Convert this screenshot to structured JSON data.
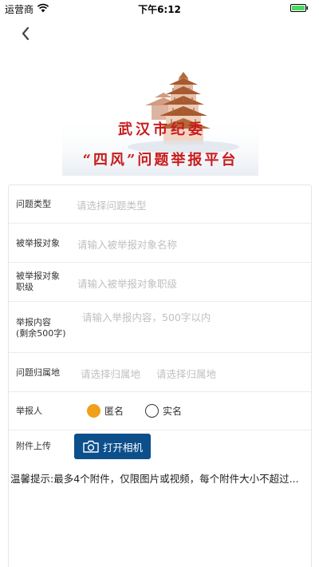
{
  "status_bar": {
    "carrier": "运营商",
    "time": "下午6:12",
    "battery_color": "#4cd964"
  },
  "nav": {
    "back_icon": "chevron-left-icon"
  },
  "banner": {
    "line1": "武汉市纪委",
    "line2": "“四风”问题举报平台",
    "text_color": "#c91b1b"
  },
  "form": {
    "issue_type": {
      "label": "问题类型",
      "placeholder": "请选择问题类型"
    },
    "target_name": {
      "label": "被举报对象",
      "placeholder": "请输入被举报对象名称"
    },
    "target_rank": {
      "label_line1": "被举报对象",
      "label_line2": "职级",
      "placeholder": "请输入被举报对象职级"
    },
    "content": {
      "label_line1": "举报内容",
      "label_line2": "(剩余500字)",
      "placeholder": "请输入举报内容，500字以内"
    },
    "location": {
      "label": "问题归属地",
      "placeholder1": "请选择归属地",
      "placeholder2": "请选择归属地"
    },
    "reporter": {
      "label": "举报人",
      "options": [
        {
          "label": "匿名",
          "selected": true
        },
        {
          "label": "实名",
          "selected": false
        }
      ],
      "selected_color": "#f0a01b"
    },
    "attachment": {
      "label": "附件上传",
      "button_label": "打开相机",
      "button_color": "#0d4f8b"
    },
    "tip": "温馨提示:最多4个附件，仅限图片或视频，每个附件大小不超过..."
  }
}
